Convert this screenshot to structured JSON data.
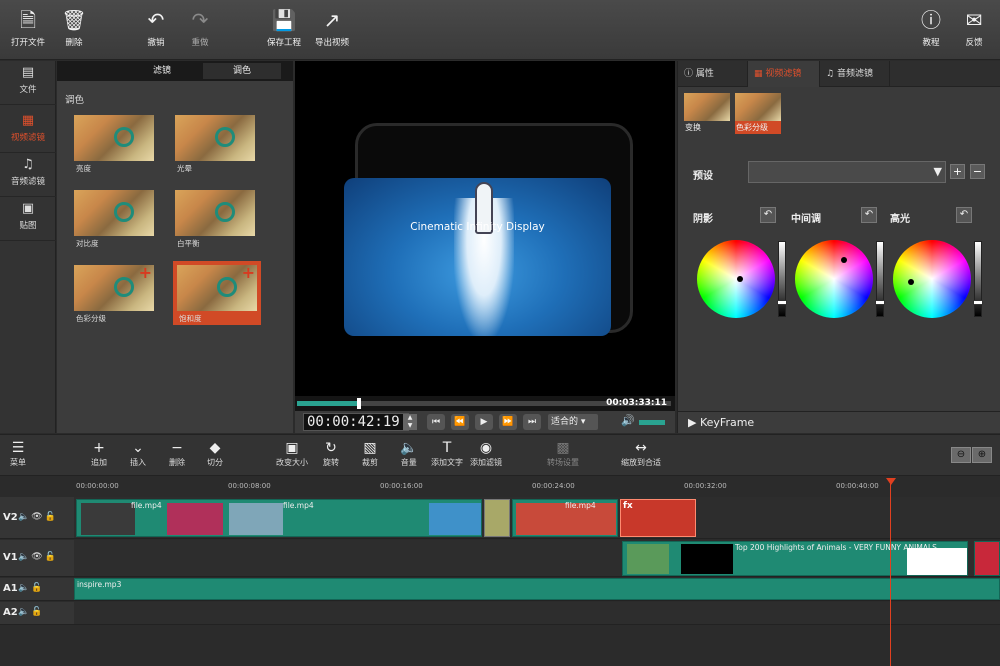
{
  "toolbar": {
    "open": "打开文件",
    "delete": "删除",
    "undo": "撤销",
    "redo": "重做",
    "save": "保存工程",
    "export": "导出视频",
    "help": "教程",
    "feedback": "反馈"
  },
  "leftnav": {
    "file": "文件",
    "video_filter": "视频滤镜",
    "audio_filter": "音频滤镜",
    "sticker": "贴图"
  },
  "filter_panel": {
    "tab_filter": "滤镜",
    "tab_color": "调色",
    "section": "调色",
    "items": [
      {
        "label": "亮度"
      },
      {
        "label": "光晕"
      },
      {
        "label": "对比度"
      },
      {
        "label": "白平衡"
      },
      {
        "label": "色彩分级"
      },
      {
        "label": "饱和度"
      }
    ]
  },
  "preview": {
    "screen_text": "Cinematic Infinity Display",
    "progress": 0.16,
    "end_time": "00:03:33:11",
    "timecode": "00:00:42:19",
    "fit": "适合的"
  },
  "right_panel": {
    "tab_props": "属性",
    "tab_video_filter": "视频滤镜",
    "tab_audio_filter": "音频滤镜",
    "fx_transform": "变换",
    "fx_color_grade": "色彩分级",
    "preset_label": "预设",
    "shadow": "阴影",
    "midtone": "中间调",
    "highlight": "高光",
    "keyframe": "KeyFrame"
  },
  "timeline_toolbar": {
    "menu": "菜单",
    "add": "追加",
    "insert": "插入",
    "delete": "删除",
    "split": "切分",
    "resize": "改变大小",
    "rotate": "旋转",
    "crop": "裁剪",
    "volume": "音量",
    "add_text": "添加文字",
    "add_filter": "添加滤镜",
    "transition": "转场设置",
    "zoom_fit": "缩放到合适"
  },
  "ruler": [
    "00:00:00:00",
    "00:00:08:00",
    "00:00:16:00",
    "00:00:24:00",
    "00:00:32:00",
    "00:00:40:00"
  ],
  "tracks": {
    "v2": "V2",
    "v1": "V1",
    "a1": "A1",
    "a2": "A2",
    "clip_file1": "file.mp4",
    "clip_file2": "file.mp4",
    "clip_file3": "file.mp4",
    "clip_v1": "Top 200 Highlights of Animals - VERY FUNNY ANIMALS",
    "clip_audio": "inspire.mp3"
  },
  "colors": {
    "accent": "#d14a26",
    "clip": "#1f8a73",
    "playhead": "#e04020"
  }
}
